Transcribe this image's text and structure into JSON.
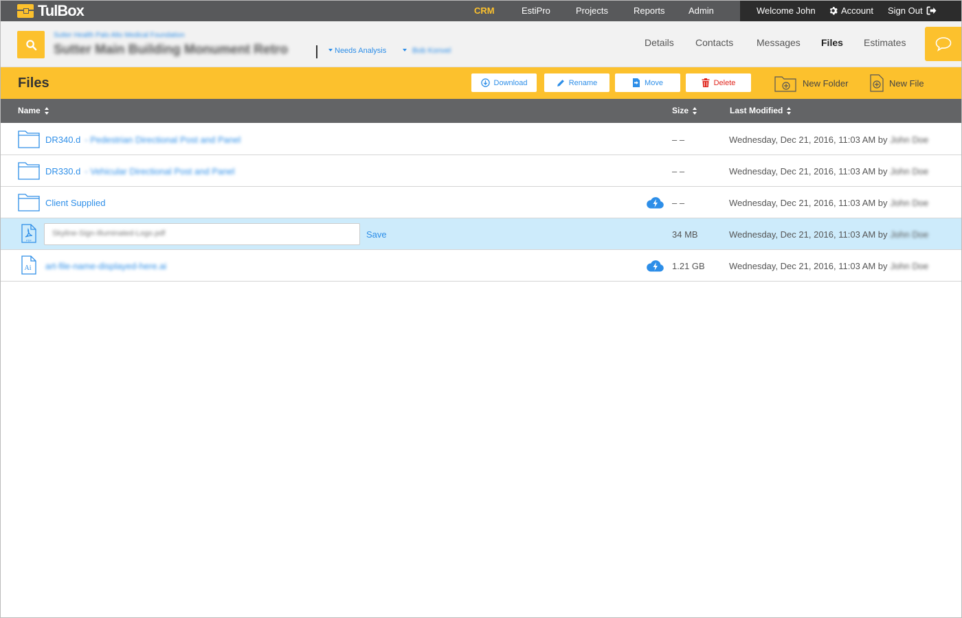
{
  "app": {
    "name": "TulBox"
  },
  "nav": {
    "items": [
      {
        "label": "CRM",
        "active": true
      },
      {
        "label": "EstiPro"
      },
      {
        "label": "Projects"
      },
      {
        "label": "Reports"
      },
      {
        "label": "Admin"
      }
    ],
    "welcome": "Welcome John",
    "account": "Account",
    "sign_out": "Sign Out"
  },
  "project": {
    "organization": "Sutter Health Palo Alto Medical Foundation",
    "title": "Sutter Main Building Monument Retro",
    "status": "Needs Analysis",
    "owner": "Bob Konvel"
  },
  "tabs": [
    {
      "label": "Details"
    },
    {
      "label": "Contacts"
    },
    {
      "label": "Messages"
    },
    {
      "label": "Files",
      "active": true
    },
    {
      "label": "Estimates"
    }
  ],
  "files_toolbar": {
    "title": "Files",
    "download": "Download",
    "rename": "Rename",
    "move": "Move",
    "delete": "Delete",
    "new_folder": "New Folder",
    "new_file": "New File"
  },
  "table": {
    "columns": {
      "name": "Name",
      "size": "Size",
      "modified": "Last Modified"
    },
    "rows": [
      {
        "type": "folder",
        "name": "DR340.d",
        "description": "- Pedestrian Directional Post and Panel",
        "size": "– –",
        "modified": "Wednesday, Dec 21, 2016, 11:03 AM by",
        "by": "John Doe"
      },
      {
        "type": "folder",
        "name": "DR330.d",
        "description": "- Vehicular Directional Post and Panel",
        "size": "– –",
        "modified": "Wednesday, Dec 21, 2016, 11:03 AM by",
        "by": "John Doe"
      },
      {
        "type": "folder",
        "name": "Client Supplied",
        "description": "",
        "cloud": true,
        "size": "– –",
        "modified": "Wednesday, Dec 21, 2016, 11:03 AM by",
        "by": "John Doe"
      },
      {
        "type": "pdf",
        "name": "Skyline-Sign-Illuminated-Logo.pdf",
        "editing": true,
        "save_label": "Save",
        "size": "34 MB",
        "modified": "Wednesday, Dec 21, 2016, 11:03 AM by",
        "by": "John Doe"
      },
      {
        "type": "ai",
        "name": "art-file-name-displayed-here.ai",
        "cloud": true,
        "size": "1.21 GB",
        "modified": "Wednesday, Dec 21, 2016, 11:03 AM by",
        "by": "John Doe"
      }
    ]
  },
  "icons": {
    "logo": "toolbox-icon",
    "search": "search-icon",
    "chat": "chat-bubble-icon",
    "download": "download-icon",
    "rename": "pencil-icon",
    "move": "move-icon",
    "delete": "trash-icon",
    "new_folder": "folder-plus-icon",
    "new_file": "file-plus-icon",
    "folder": "folder-icon",
    "pdf": "pdf-file-icon",
    "ai": "ai-file-icon",
    "cloud": "cloud-sync-icon",
    "gear": "gear-icon",
    "signout": "sign-out-icon"
  },
  "colors": {
    "accent": "#fcc12d",
    "link": "#2d8ee8",
    "nav_bg": "#58595b",
    "user_bg": "#2c2c2c",
    "header_row": "#636466",
    "selected_row": "#cdebfb",
    "danger": "#e0241b"
  }
}
